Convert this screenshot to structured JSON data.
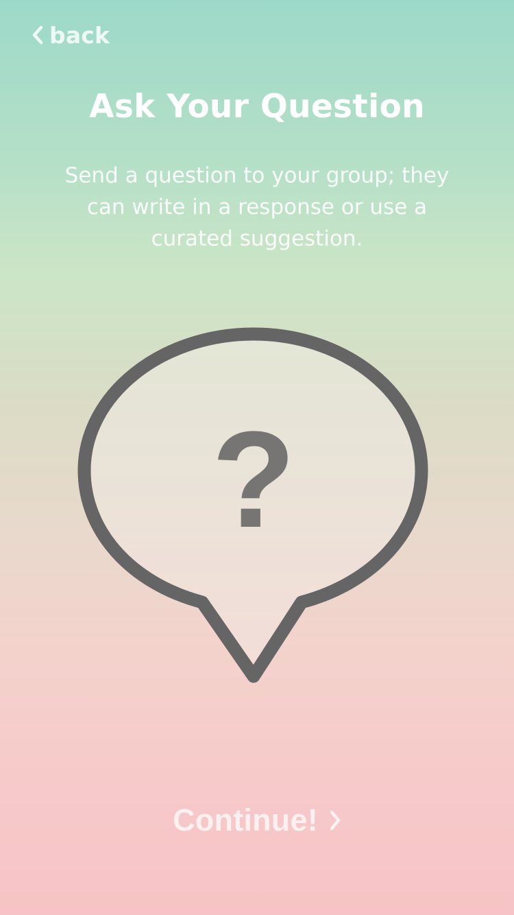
{
  "nav": {
    "back_label": "back",
    "back_icon": "chevron-left-icon"
  },
  "header": {
    "title": "Ask Your Question",
    "description": "Send a question to your group; they can write in a response or use a curated suggestion."
  },
  "illustration": {
    "icon": "question-speech-bubble-icon",
    "glyph": "?"
  },
  "footer": {
    "continue_label": "Continue!",
    "continue_icon": "chevron-right-icon"
  },
  "colors": {
    "gradient_top": "#9dd9c9",
    "gradient_middle": "#dcdcc6",
    "gradient_bottom": "#f7c3c6",
    "bubble_stroke": "#666565",
    "question_mark": "#767574",
    "text": "#ffffff"
  }
}
